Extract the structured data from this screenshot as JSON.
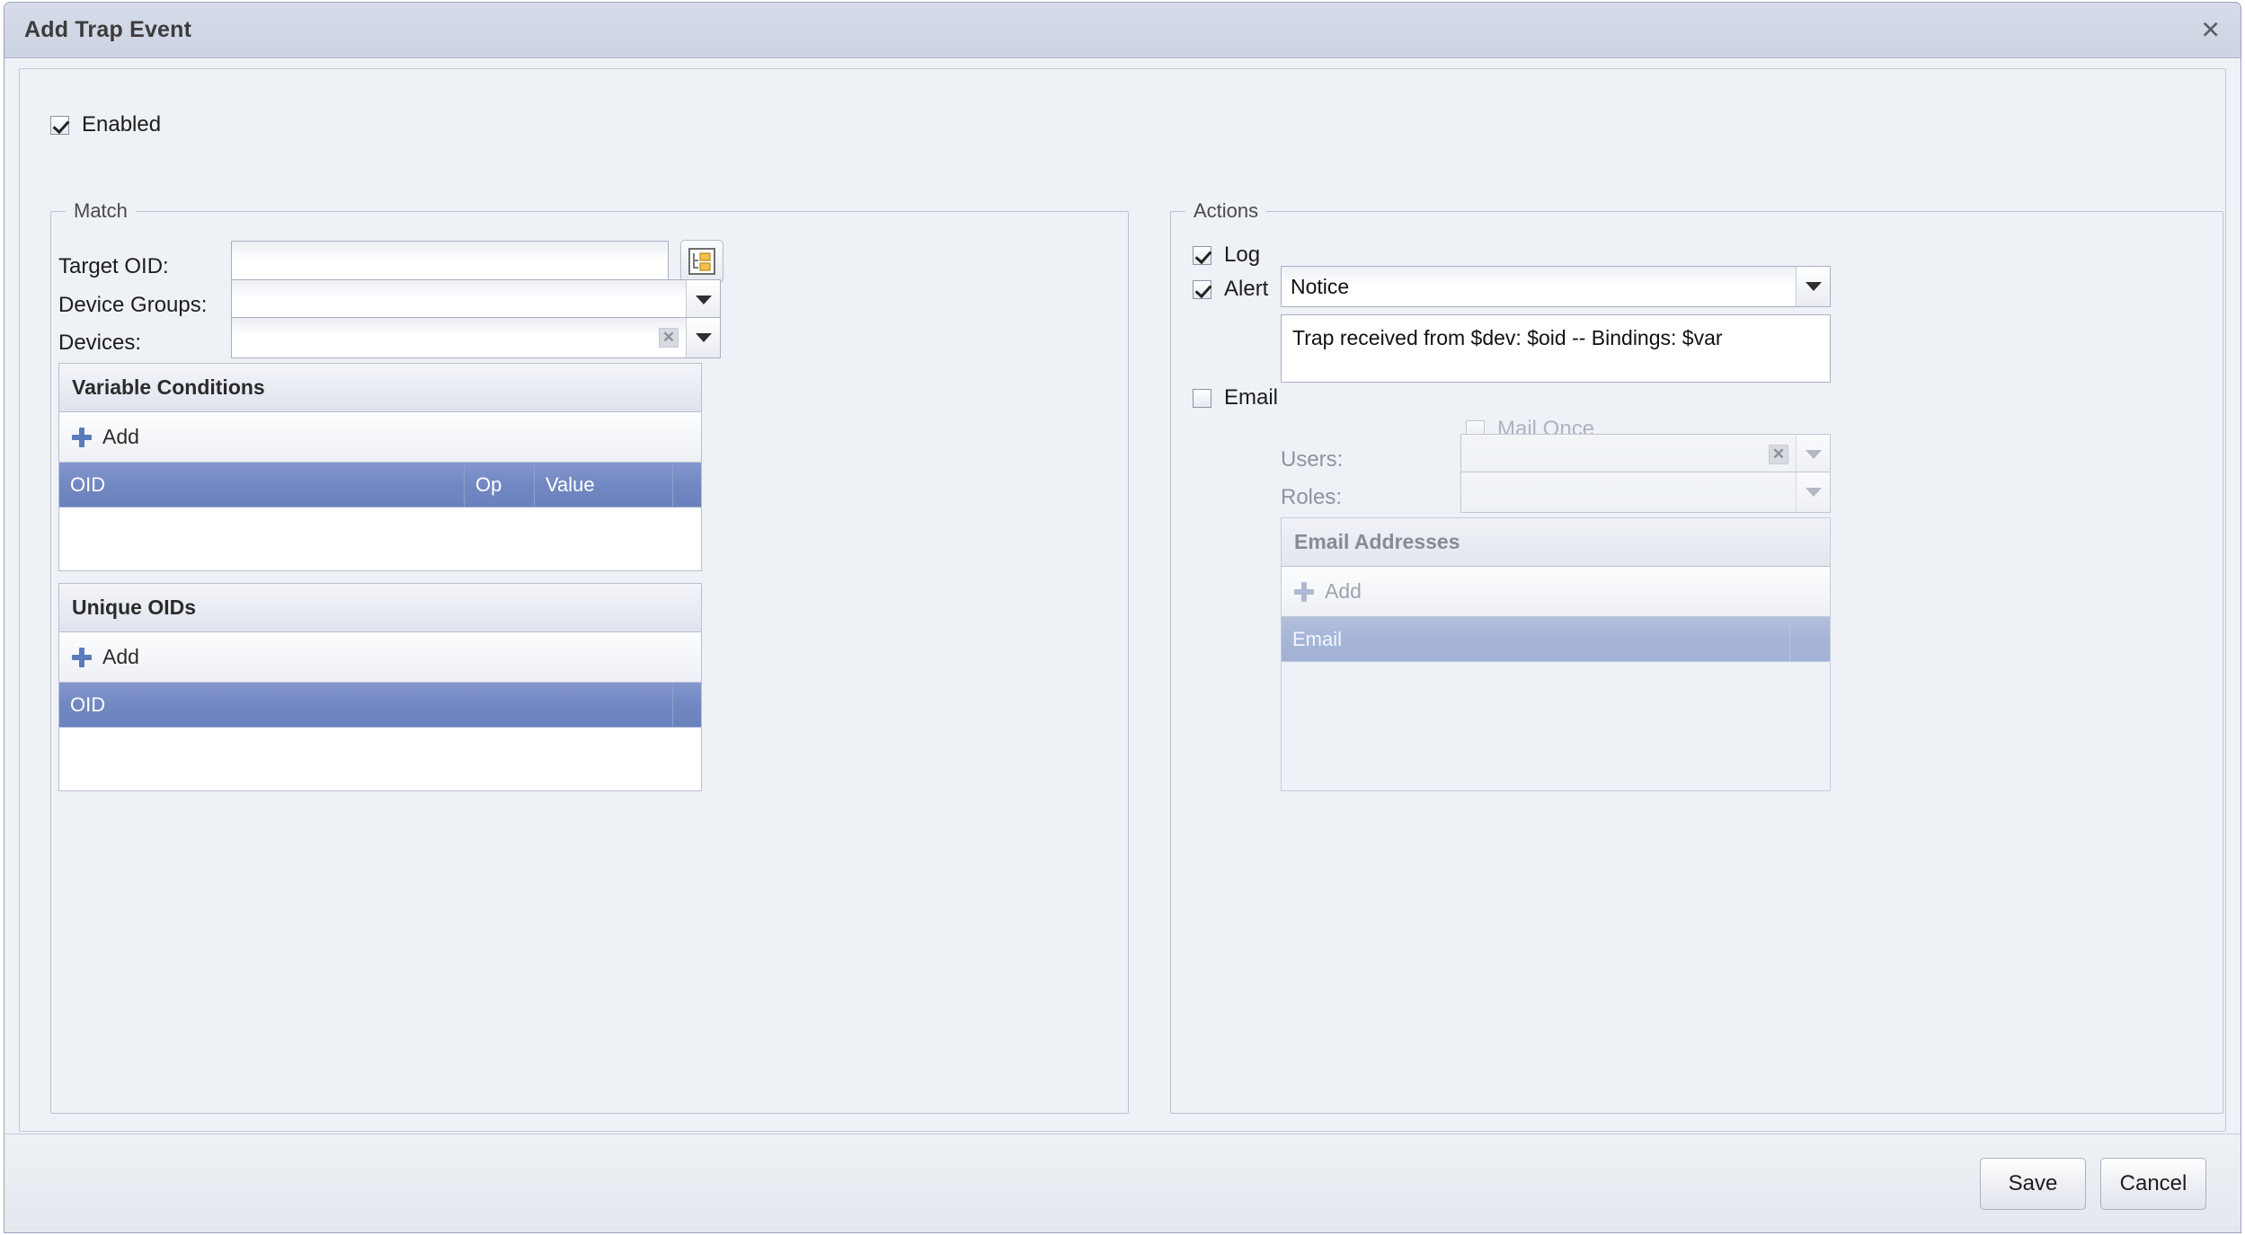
{
  "window": {
    "title": "Add Trap Event",
    "close_icon": "close-icon",
    "close_glyph": "✕"
  },
  "enabled": {
    "label": "Enabled",
    "checked": true
  },
  "match": {
    "legend": "Match",
    "target_oid": {
      "label": "Target OID:",
      "value": "",
      "browse_icon": "oid-tree-browse-icon"
    },
    "device_groups": {
      "label": "Device Groups:",
      "value": ""
    },
    "devices": {
      "label": "Devices:",
      "value": "",
      "clear_glyph": "☒"
    },
    "variable_conditions": {
      "title": "Variable Conditions",
      "add_label": "Add",
      "columns": [
        "OID",
        "Op",
        "Value",
        ""
      ],
      "rows": []
    },
    "unique_oids": {
      "title": "Unique OIDs",
      "add_label": "Add",
      "columns": [
        "OID",
        ""
      ],
      "rows": []
    }
  },
  "actions": {
    "legend": "Actions",
    "log": {
      "label": "Log",
      "checked": true
    },
    "alert": {
      "label": "Alert",
      "checked": true,
      "severity_value": "Notice",
      "message": "Trap received from $dev: $oid -- Bindings: $var"
    },
    "email": {
      "label": "Email",
      "checked": false,
      "mail_once": {
        "label": "Mail Once",
        "checked": false,
        "disabled": true
      },
      "users": {
        "label": "Users:",
        "value": "",
        "disabled": true,
        "clear_glyph": "☒"
      },
      "roles": {
        "label": "Roles:",
        "value": "",
        "disabled": true
      },
      "email_addresses": {
        "title": "Email Addresses",
        "add_label": "Add",
        "columns": [
          "Email",
          ""
        ],
        "rows": [],
        "disabled": true
      }
    }
  },
  "footer": {
    "save_label": "Save",
    "cancel_label": "Cancel"
  },
  "colors": {
    "background": "#eef1f5",
    "titlebar": "#ccd3e2",
    "grid_header_blue": "#6b81bd",
    "grid_header_blue_disabled": "#a6b5d7",
    "border": "#bcc2d4",
    "accent_plus": "#5b7bbd"
  }
}
